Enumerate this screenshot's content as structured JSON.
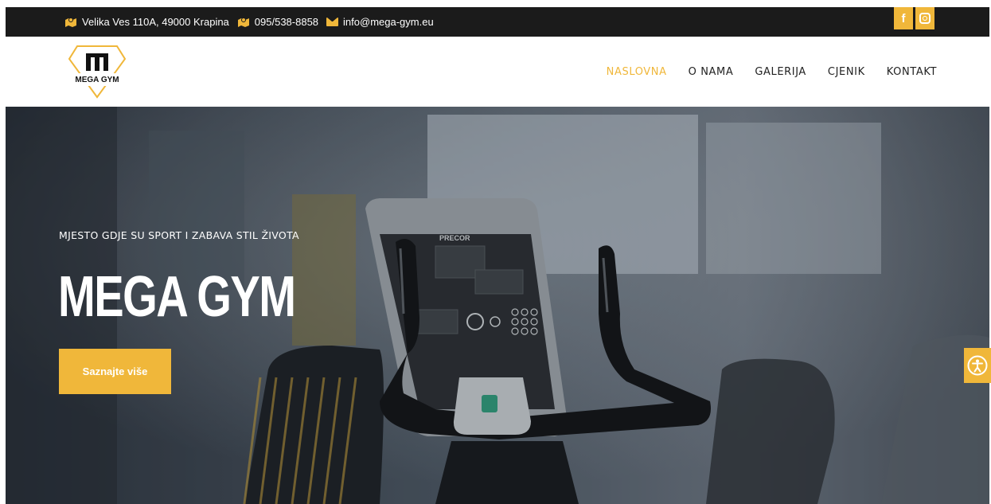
{
  "topbar": {
    "address": "Velika Ves 110A, 49000 Krapina",
    "phone": "095/538-8858",
    "email": "info@mega-gym.eu",
    "social": {
      "facebook_glyph": "f",
      "icons": [
        "facebook-icon",
        "instagram-icon"
      ]
    }
  },
  "logo": {
    "letter": "m",
    "text": "MEGA GYM"
  },
  "nav": {
    "items": [
      "NASLOVNA",
      "O NAMA",
      "GALERIJA",
      "CJENIK",
      "KONTAKT"
    ],
    "active": "NASLOVNA"
  },
  "hero": {
    "tagline": "MJESTO GDJE SU SPORT I ZABAVA STIL ŽIVOTA",
    "title": "MEGA GYM",
    "cta": "Saznajte više",
    "console_brand": "PRECOR"
  },
  "colors": {
    "accent": "#f0b73a",
    "topbar": "#1b1b1b",
    "text": "#222222"
  },
  "icons": {
    "accessibility": "accessibility-icon"
  }
}
